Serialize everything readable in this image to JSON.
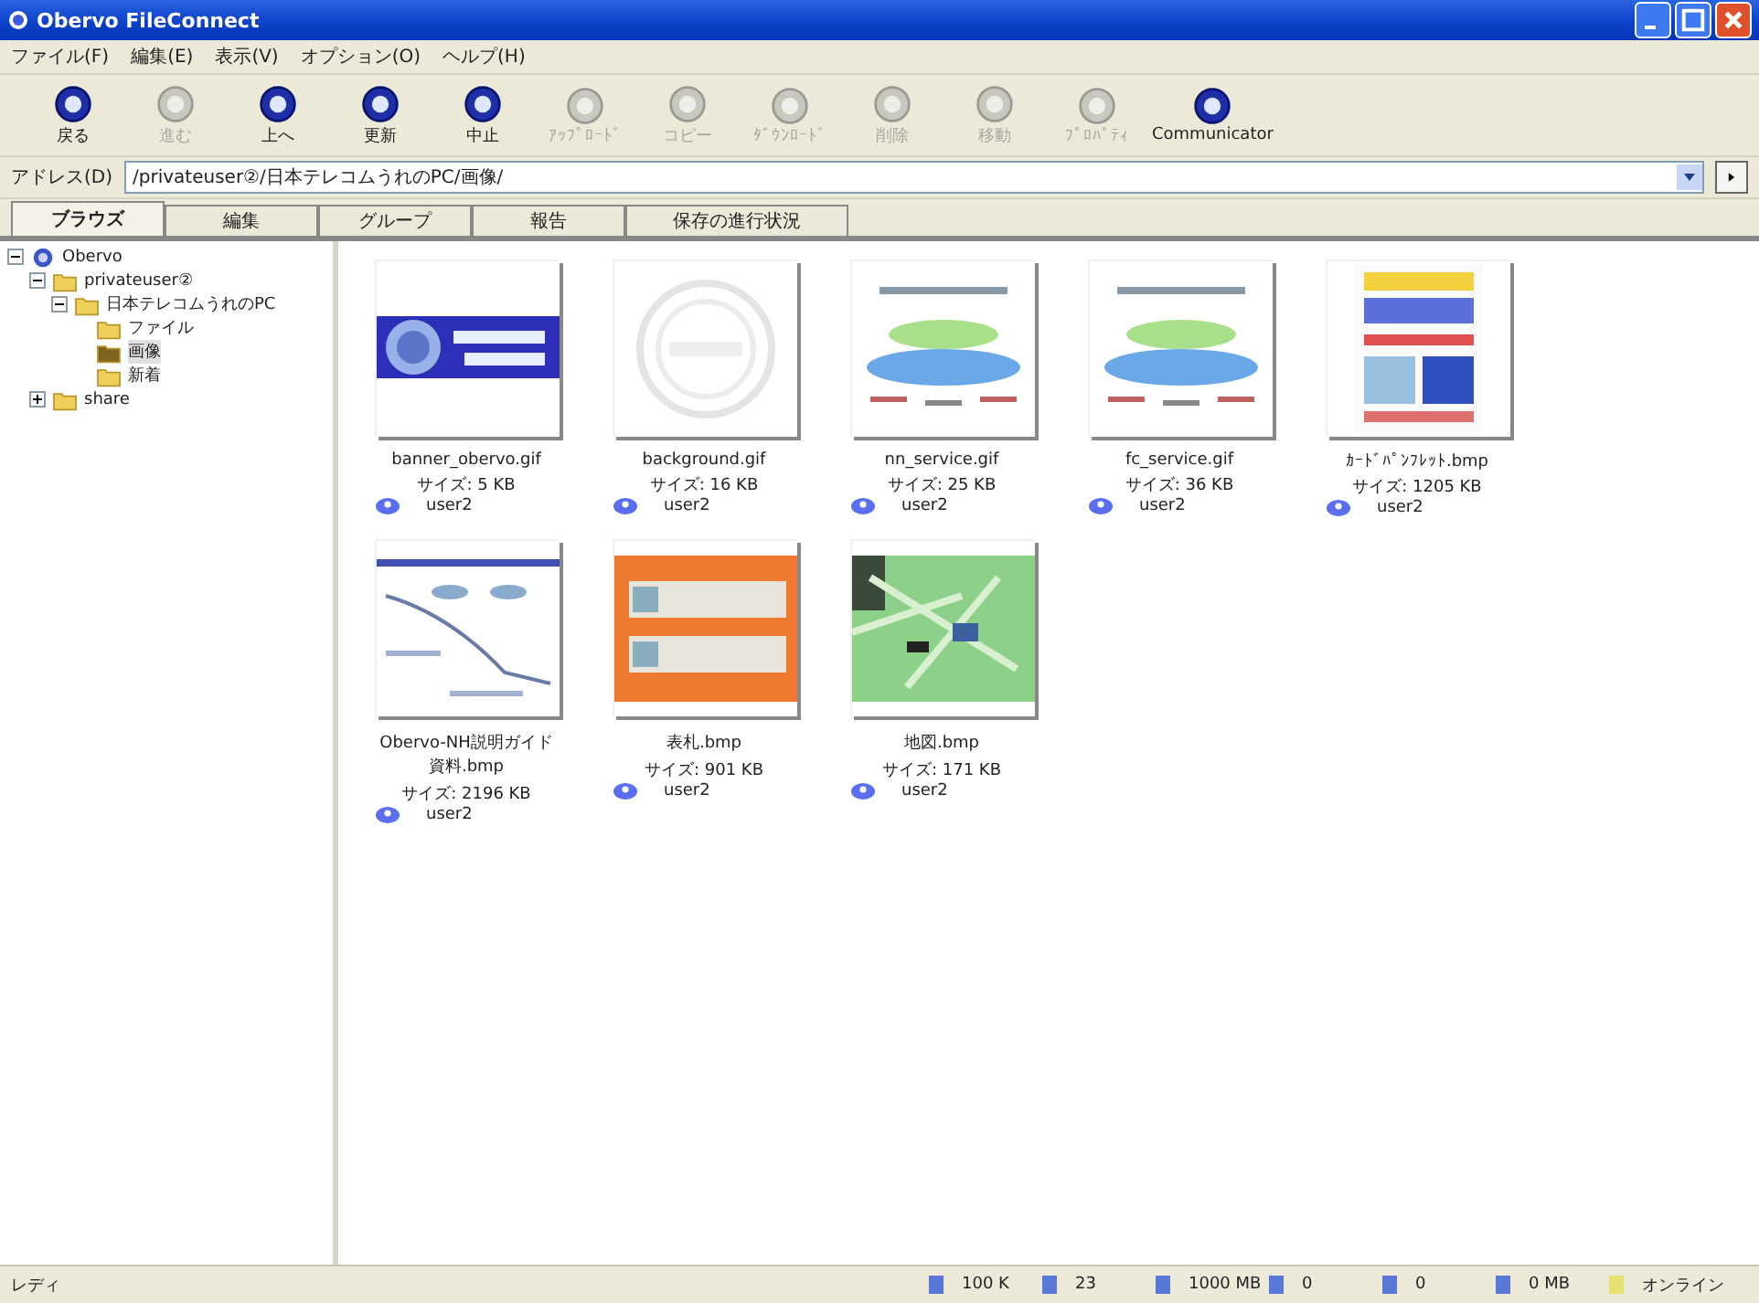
{
  "window": {
    "title": "Obervo FileConnect"
  },
  "menu": [
    "ファイル(F)",
    "編集(E)",
    "表示(V)",
    "オプション(O)",
    "ヘルプ(H)"
  ],
  "toolbar": [
    {
      "label": "戻る",
      "disabled": false
    },
    {
      "label": "進む",
      "disabled": true
    },
    {
      "label": "上へ",
      "disabled": false
    },
    {
      "label": "更新",
      "disabled": false
    },
    {
      "label": "中止",
      "disabled": false
    },
    {
      "label": "ｱｯﾌﾟﾛｰﾄﾞ",
      "disabled": true
    },
    {
      "label": "コピー",
      "disabled": true
    },
    {
      "label": "ﾀﾞｳﾝﾛｰﾄﾞ",
      "disabled": true
    },
    {
      "label": "削除",
      "disabled": true
    },
    {
      "label": "移動",
      "disabled": true
    },
    {
      "label": "ﾌﾟﾛﾊﾟﾃｨ",
      "disabled": true
    },
    {
      "label": "Communicator",
      "disabled": false
    }
  ],
  "address": {
    "label": "アドレス(D)",
    "value": "/privateuser②/日本テレコムうれのPC/画像/"
  },
  "tabs": [
    {
      "label": "ブラウズ",
      "selected": true
    },
    {
      "label": "編集",
      "selected": false
    },
    {
      "label": "グループ",
      "selected": false
    },
    {
      "label": "報告",
      "selected": false
    },
    {
      "label": "保存の進行状況",
      "selected": false
    }
  ],
  "tree": [
    {
      "label": "Obervo",
      "kind": "root",
      "expanded": true,
      "selected": false,
      "children": [
        {
          "label": "privateuser②",
          "kind": "folder",
          "expanded": true,
          "selected": false,
          "children": [
            {
              "label": "日本テレコムうれのPC",
              "kind": "folder",
              "expanded": true,
              "selected": false,
              "children": [
                {
                  "label": "ファイル",
                  "kind": "folder",
                  "selected": false
                },
                {
                  "label": "画像",
                  "kind": "folder",
                  "selected": true
                },
                {
                  "label": "新着",
                  "kind": "folder",
                  "selected": false
                }
              ]
            }
          ]
        },
        {
          "label": "share",
          "kind": "folder",
          "expanded": false,
          "selected": false
        }
      ]
    }
  ],
  "files": [
    {
      "name": "banner_obervo.gif",
      "size": "サイズ: 5 KB",
      "user": "user2"
    },
    {
      "name": "background.gif",
      "size": "サイズ: 16 KB",
      "user": "user2"
    },
    {
      "name": "nn_service.gif",
      "size": "サイズ: 25 KB",
      "user": "user2"
    },
    {
      "name": "fc_service.gif",
      "size": "サイズ: 36 KB",
      "user": "user2"
    },
    {
      "name": "ｶｰﾄﾞﾊﾟﾝﾌﾚｯﾄ.bmp",
      "size": "サイズ: 1205 KB",
      "user": "user2"
    },
    {
      "name": "Obervo-NH説明ガイド資料.bmp",
      "size": "サイズ: 2196 KB",
      "user": "user2"
    },
    {
      "name": "表札.bmp",
      "size": "サイズ: 901 KB",
      "user": "user2"
    },
    {
      "name": "地図.bmp",
      "size": "サイズ: 171 KB",
      "user": "user2"
    }
  ],
  "status": {
    "text": "レディ",
    "items": [
      "100 K",
      "23",
      "1000 MB",
      "0",
      "0",
      "0 MB",
      "オンライン"
    ]
  }
}
